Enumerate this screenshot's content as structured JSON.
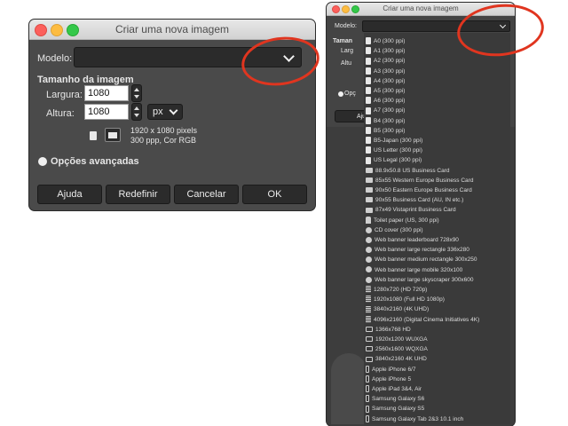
{
  "dialog": {
    "title": "Criar uma nova imagem",
    "model_label": "Modelo:",
    "model_value": "",
    "size_heading": "Tamanho da imagem",
    "width_label": "Largura:",
    "width_value": "1080",
    "height_label": "Altura:",
    "height_value": "1080",
    "unit": "px",
    "info_pixels": "1920 x 1080 pixels",
    "info_ppi": "300 ppp, Cor RGB",
    "advanced_label": "Opções avançadas",
    "buttons": {
      "help": "Ajuda",
      "reset": "Redefinir",
      "cancel": "Cancelar",
      "ok": "OK"
    }
  },
  "dialog2": {
    "title": "Criar uma nova imagem",
    "model_label": "Modelo:",
    "partial_size": "Taman",
    "partial_width": "Larg",
    "partial_height": "Altu",
    "partial_advanced": "Opç",
    "partial_help": "Aju"
  },
  "dropdown": {
    "items": [
      {
        "label": "A0 (300 ppi)",
        "icon": "doc"
      },
      {
        "label": "A1 (300 ppi)",
        "icon": "doc"
      },
      {
        "label": "A2 (300 ppi)",
        "icon": "doc"
      },
      {
        "label": "A3 (300 ppi)",
        "icon": "doc"
      },
      {
        "label": "A4 (300 ppi)",
        "icon": "doc"
      },
      {
        "label": "A5 (300 ppi)",
        "icon": "doc"
      },
      {
        "label": "A6 (300 ppi)",
        "icon": "doc"
      },
      {
        "label": "A7 (300 ppi)",
        "icon": "doc"
      },
      {
        "label": "B4 (300 ppi)",
        "icon": "doc"
      },
      {
        "label": "B5 (300 ppi)",
        "icon": "doc"
      },
      {
        "label": "B5-Japan (300 ppi)",
        "icon": "doc"
      },
      {
        "label": "US Letter (300 ppi)",
        "icon": "doc"
      },
      {
        "label": "US Legal (300 ppi)",
        "icon": "doc"
      },
      {
        "label": "88.9x50.8 US Business Card",
        "icon": "card"
      },
      {
        "label": "85x55 Western Europe Business Card",
        "icon": "card"
      },
      {
        "label": "90x50 Eastern Europe Business Card",
        "icon": "card"
      },
      {
        "label": "90x55 Business Card (AU, IN etc.)",
        "icon": "card"
      },
      {
        "label": "87x49 Vistaprint Business Card",
        "icon": "card"
      },
      {
        "label": "Toilet paper (US, 300 ppi)",
        "icon": "misc"
      },
      {
        "label": "CD cover (300 ppi)",
        "icon": "disc"
      },
      {
        "label": "Web banner leaderboard 728x90",
        "icon": "web"
      },
      {
        "label": "Web banner large rectangle 336x280",
        "icon": "web"
      },
      {
        "label": "Web banner medium rectangle 300x250",
        "icon": "web"
      },
      {
        "label": "Web banner large mobile 320x100",
        "icon": "web"
      },
      {
        "label": "Web banner large skyscraper 300x600",
        "icon": "web"
      },
      {
        "label": "1280x720 (HD 720p)",
        "icon": "film"
      },
      {
        "label": "1920x1080 (Full HD 1080p)",
        "icon": "film"
      },
      {
        "label": "3840x2160 (4K UHD)",
        "icon": "film"
      },
      {
        "label": "4096x2160 (Digital Cinema Initiatives 4K)",
        "icon": "film"
      },
      {
        "label": "1366x768 HD",
        "icon": "mon"
      },
      {
        "label": "1920x1200 WUXGA",
        "icon": "mon"
      },
      {
        "label": "2560x1600 WQXGA",
        "icon": "mon"
      },
      {
        "label": "3840x2160 4K UHD",
        "icon": "mon"
      },
      {
        "label": "Apple iPhone 6/7",
        "icon": "phone"
      },
      {
        "label": "Apple iPhone 5",
        "icon": "phone"
      },
      {
        "label": "Apple iPad 3&4, Air",
        "icon": "phone"
      },
      {
        "label": "Samsung Galaxy S6",
        "icon": "phone"
      },
      {
        "label": "Samsung Galaxy S5",
        "icon": "phone"
      },
      {
        "label": "Samsung Galaxy Tab 2&3 10.1 inch",
        "icon": "phone"
      }
    ]
  },
  "colors": {
    "annotation_ring": "#e0351f",
    "dialog_bg": "#4a4a4a",
    "input_bg": "#2b2b2b"
  }
}
